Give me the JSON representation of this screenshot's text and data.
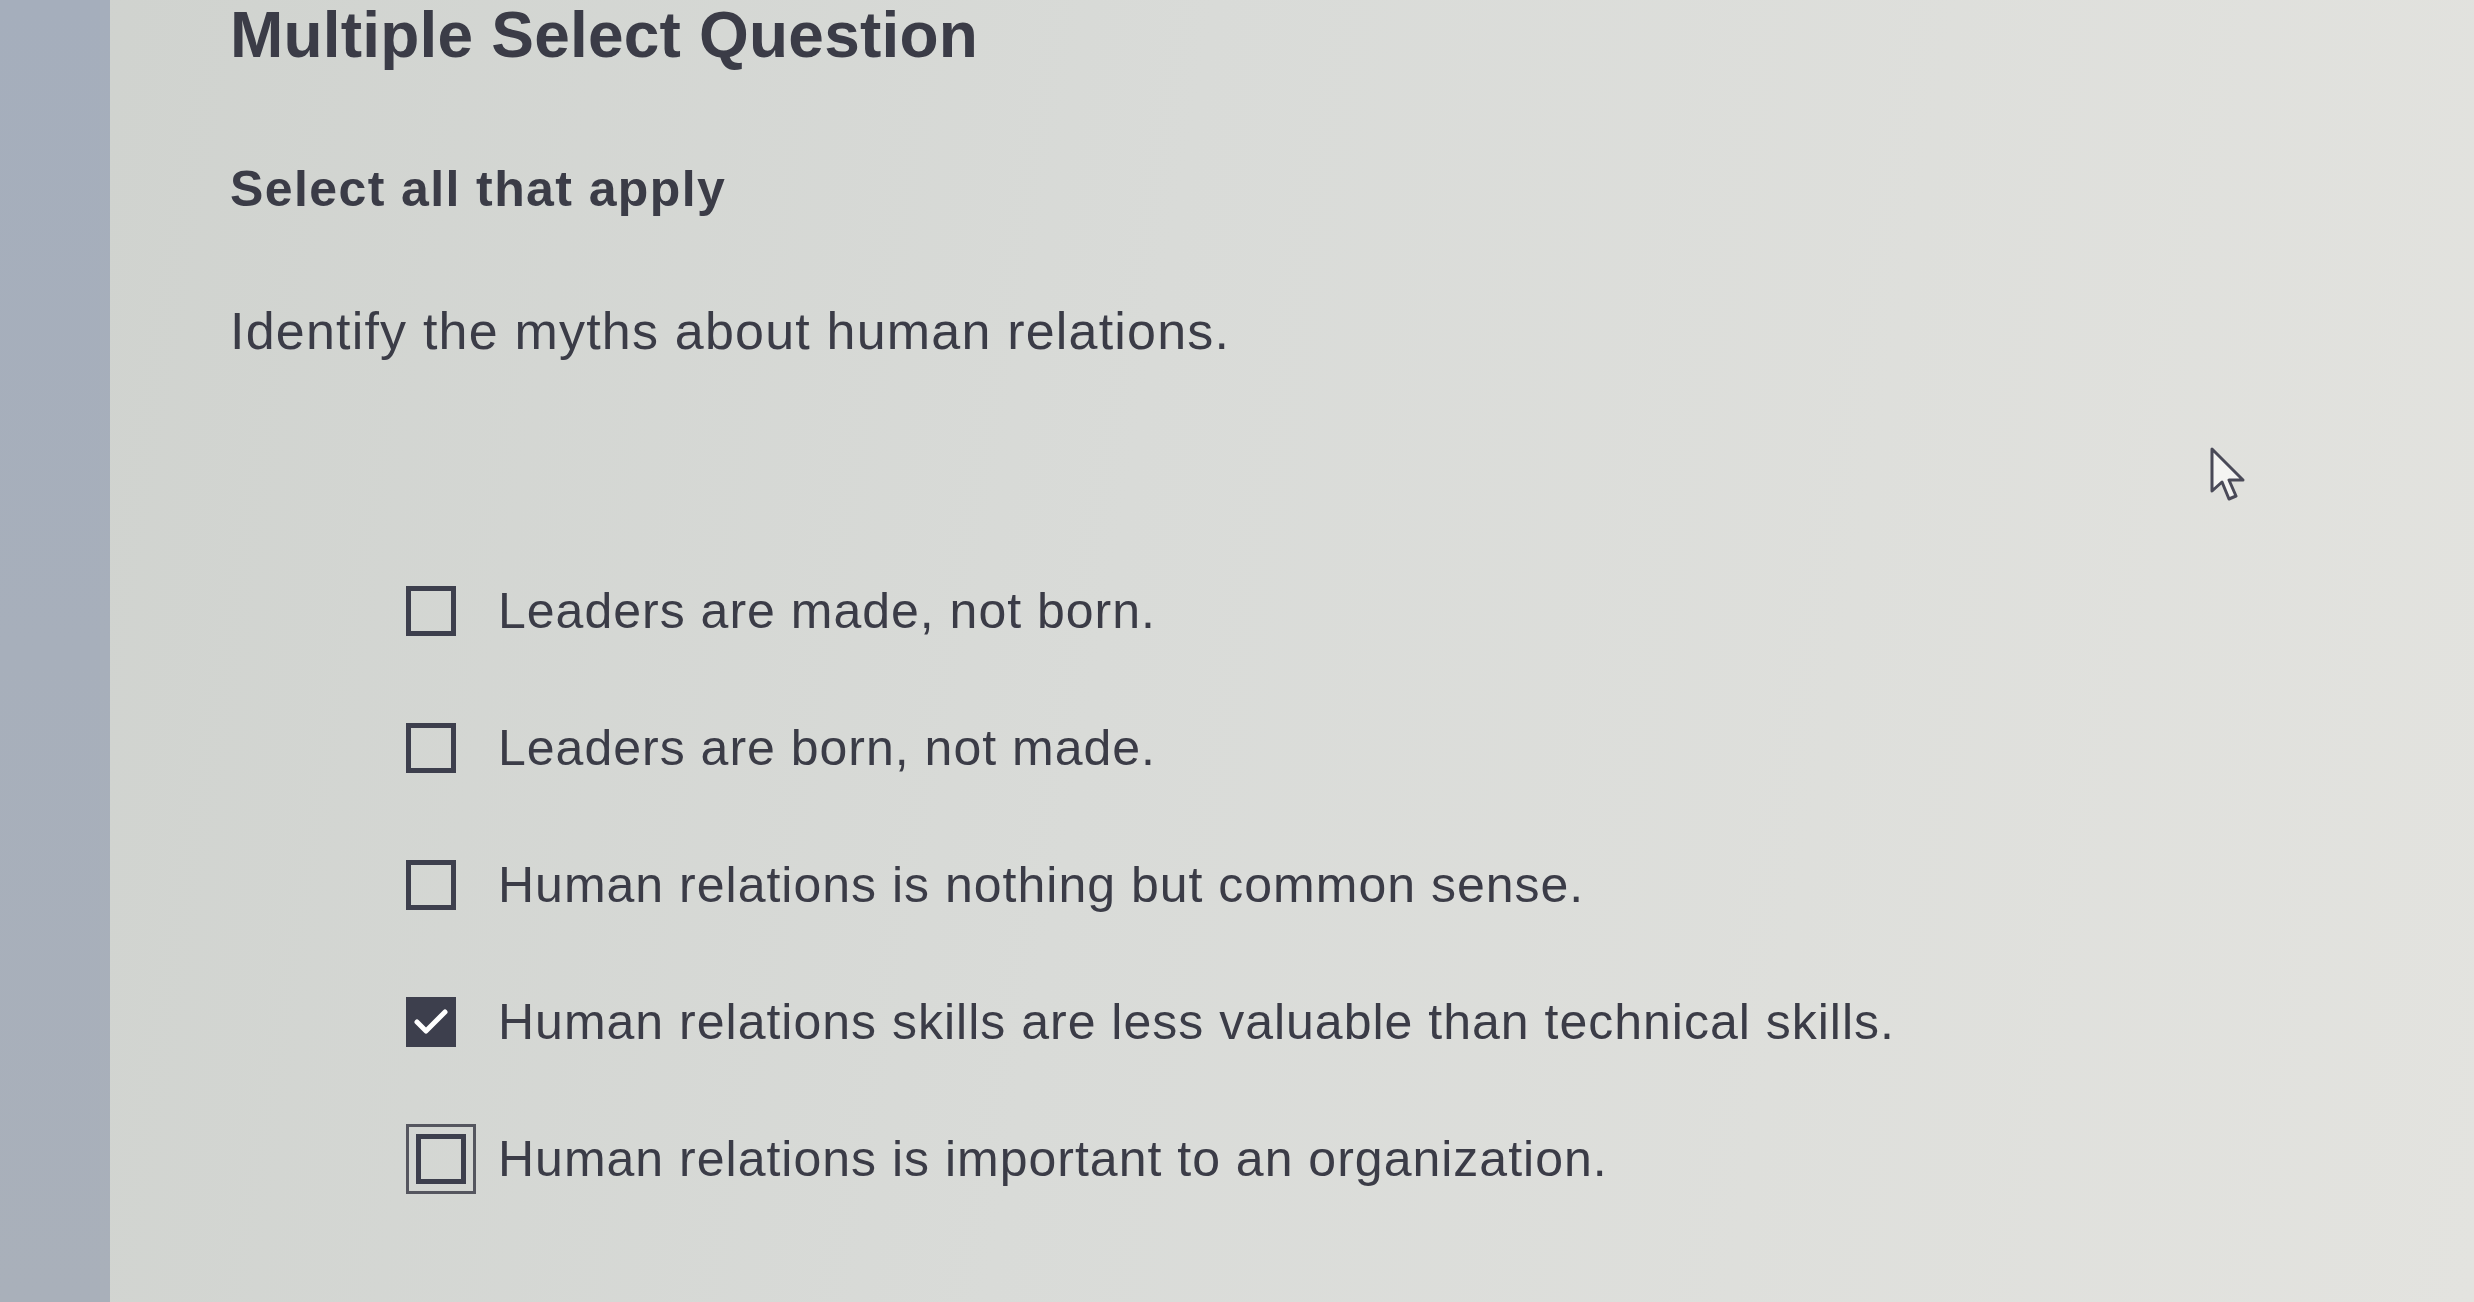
{
  "question": {
    "type_label": "Multiple Select Question",
    "instruction": "Select all that apply",
    "prompt": "Identify the myths about human relations."
  },
  "options": [
    {
      "text": "Leaders are made, not born.",
      "checked": false,
      "focused": false
    },
    {
      "text": "Leaders are born, not made.",
      "checked": false,
      "focused": false
    },
    {
      "text": "Human relations is nothing but common sense.",
      "checked": false,
      "focused": false
    },
    {
      "text": "Human relations skills are less valuable than technical skills.",
      "checked": true,
      "focused": false
    },
    {
      "text": "Human relations is important to an organization.",
      "checked": false,
      "focused": true
    }
  ]
}
